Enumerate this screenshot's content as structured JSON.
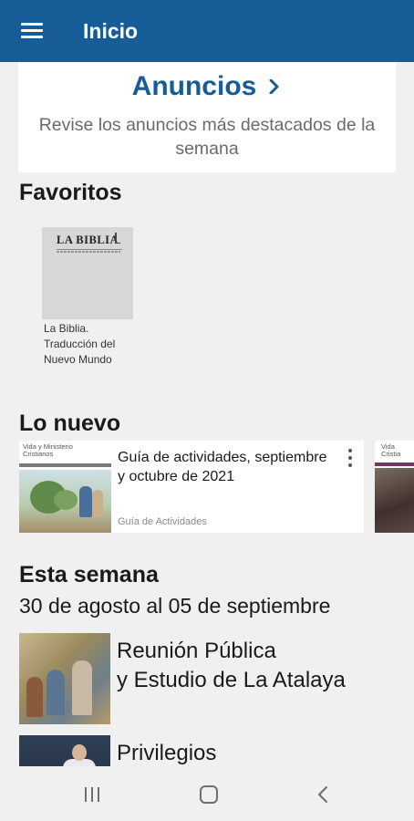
{
  "appbar": {
    "title": "Inicio",
    "menu_icon": "hamburger-menu-icon",
    "color": "#165c97"
  },
  "announcements": {
    "title": "Anuncios",
    "chevron_icon": "chevron-right-icon",
    "description": "Revise los anuncios más destacados de la semana"
  },
  "favorites": {
    "section_title": "Favoritos",
    "items": [
      {
        "cover_title": "LA BIBLIA",
        "label": "La Biblia. Traducción del Nuevo Mundo"
      }
    ]
  },
  "whats_new": {
    "section_title": "Lo nuevo",
    "items": [
      {
        "thumb_line1": "Vida y Ministerio",
        "thumb_line2": "Cristianos",
        "title": "Guía de actividades, septiembre y octubre de 2021",
        "category": "Guía de Actividades",
        "menu_icon": "more-vert-icon"
      },
      {
        "thumb_line1": "Vida",
        "thumb_line2": "Cristia"
      }
    ]
  },
  "this_week": {
    "section_title": "Esta semana",
    "date_range": "30 de agosto al 05 de septiembre",
    "items": [
      {
        "line1": "Reunión Pública",
        "line2": "y Estudio de La Atalaya"
      },
      {
        "line1": "Privilegios"
      }
    ]
  },
  "system_nav": {
    "recents_icon": "recents-icon",
    "home_icon": "home-icon",
    "back_icon": "back-icon"
  }
}
